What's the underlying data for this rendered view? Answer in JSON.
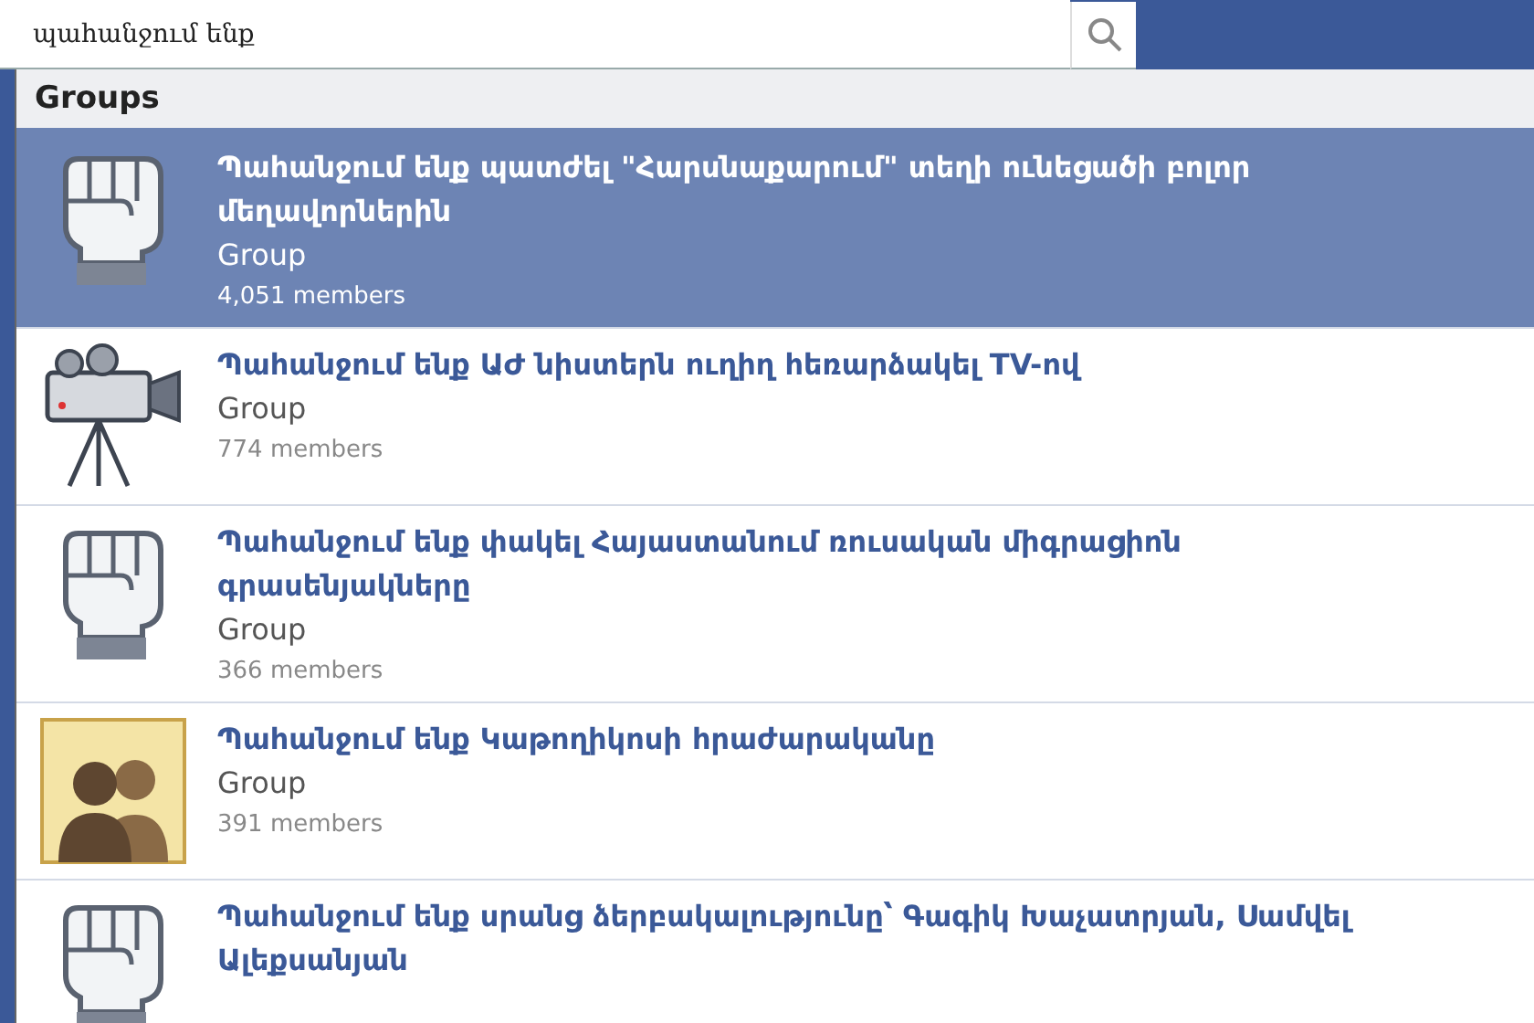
{
  "search": {
    "value": "պահանջում ենք"
  },
  "section": {
    "title": "Groups"
  },
  "results": [
    {
      "kind": "fist",
      "title": "Պահանջում ենք պատժել \"Հարսնաքարում\" տեղի ունեցածի բոլոր մեղավորներին",
      "type": "Group",
      "members": "4,051 members",
      "selected": true
    },
    {
      "kind": "camera",
      "title": "Պահանջում ենք ԱԺ նիստերն ուղիղ հեռարձակել TV-ով",
      "type": "Group",
      "members": "774 members",
      "selected": false
    },
    {
      "kind": "fist",
      "title": "Պահանջում ենք փակել Հայաստանում ռուսական միգրացիոն գրասենյակները",
      "type": "Group",
      "members": "366 members",
      "selected": false
    },
    {
      "kind": "people",
      "title": "Պահանջում ենք Կաթողիկոսի հրաժարականը",
      "type": "Group",
      "members": "391 members",
      "selected": false
    },
    {
      "kind": "fist",
      "title": "Պահանջում ենք սրանց ձերբակալությունը՝ Գագիկ Խաչատրյան, Սամվել Ալեքսանյան",
      "selected": false
    }
  ]
}
